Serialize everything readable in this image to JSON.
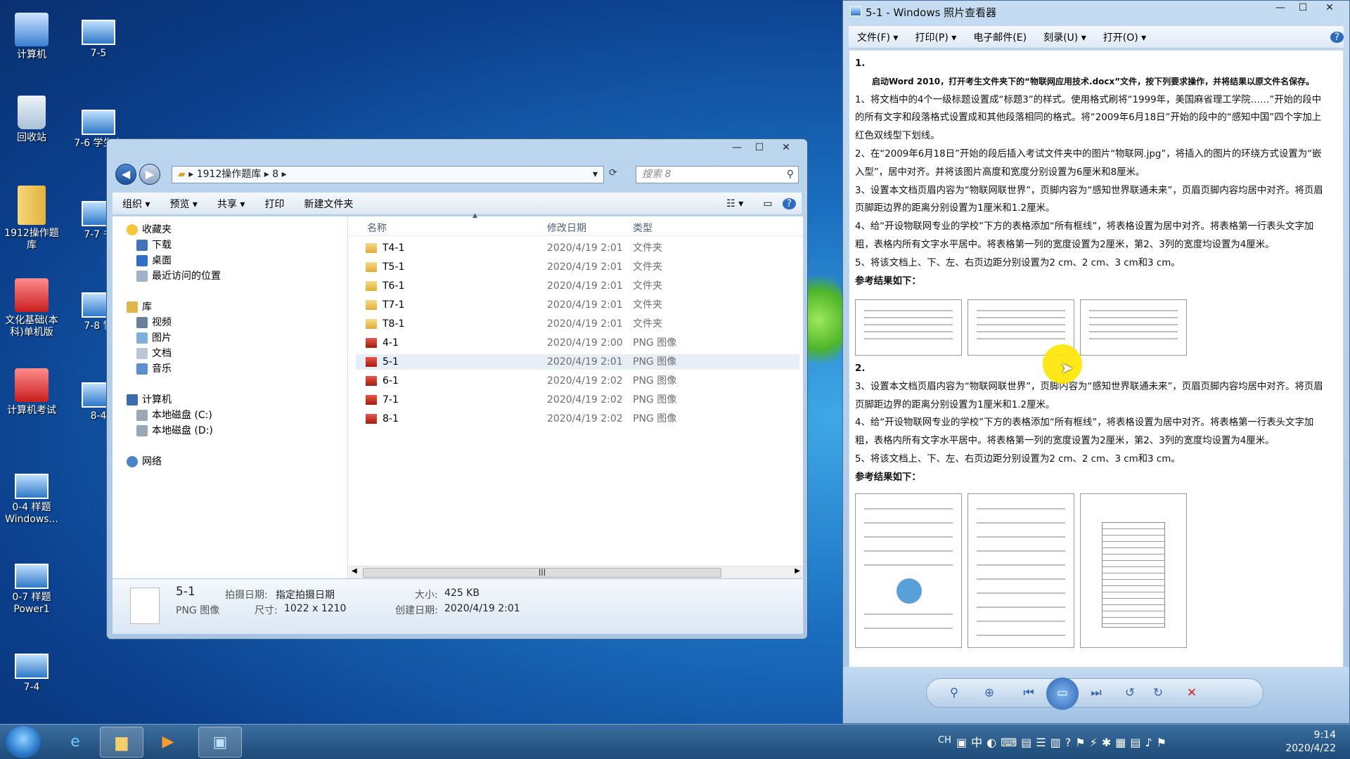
{
  "desktop": {
    "icons_left": [
      {
        "label": "计算机"
      },
      {
        "label": "回收站"
      },
      {
        "label": "1912操作题库"
      },
      {
        "label": "文化基础(本科)单机版"
      },
      {
        "label": "计算机考试"
      },
      {
        "label": "0-4 样题Windows..."
      },
      {
        "label": "0-7 样题Power1"
      },
      {
        "label": "7-4"
      }
    ],
    "icons_second": [
      {
        "label": "7-5"
      },
      {
        "label": "7-6 学生表"
      },
      {
        "label": "7-7 书"
      },
      {
        "label": "7-8 雪"
      },
      {
        "label": "8-4"
      }
    ]
  },
  "explorer": {
    "address": [
      "1912操作题库",
      "8"
    ],
    "search_placeholder": "搜索 8",
    "toolbar": [
      "组织 ▾",
      "预览 ▾",
      "共享 ▾",
      "打印",
      "新建文件夹"
    ],
    "nav": {
      "favorites": "收藏夹",
      "fav_items": [
        "下载",
        "桌面",
        "最近访问的位置"
      ],
      "libraries": "库",
      "lib_items": [
        "视频",
        "图片",
        "文档",
        "音乐"
      ],
      "computer": "计算机",
      "drives": [
        "本地磁盘 (C:)",
        "本地磁盘 (D:)"
      ],
      "network": "网络"
    },
    "columns": {
      "name": "名称",
      "date": "修改日期",
      "type": "类型"
    },
    "files": [
      {
        "name": "T4-1",
        "date": "2020/4/19 2:01",
        "type": "文件夹",
        "kind": "folder"
      },
      {
        "name": "T5-1",
        "date": "2020/4/19 2:01",
        "type": "文件夹",
        "kind": "folder"
      },
      {
        "name": "T6-1",
        "date": "2020/4/19 2:01",
        "type": "文件夹",
        "kind": "folder"
      },
      {
        "name": "T7-1",
        "date": "2020/4/19 2:01",
        "type": "文件夹",
        "kind": "folder"
      },
      {
        "name": "T8-1",
        "date": "2020/4/19 2:01",
        "type": "文件夹",
        "kind": "folder"
      },
      {
        "name": "4-1",
        "date": "2020/4/19 2:00",
        "type": "PNG 图像",
        "kind": "png"
      },
      {
        "name": "5-1",
        "date": "2020/4/19 2:01",
        "type": "PNG 图像",
        "kind": "png",
        "selected": true
      },
      {
        "name": "6-1",
        "date": "2020/4/19 2:02",
        "type": "PNG 图像",
        "kind": "png"
      },
      {
        "name": "7-1",
        "date": "2020/4/19 2:02",
        "type": "PNG 图像",
        "kind": "png"
      },
      {
        "name": "8-1",
        "date": "2020/4/19 2:02",
        "type": "PNG 图像",
        "kind": "png"
      }
    ],
    "details": {
      "name": "5-1",
      "type": "PNG 图像",
      "taken_label": "拍摄日期:",
      "taken_value": "指定拍摄日期",
      "dims_label": "尺寸:",
      "dims_value": "1022 x 1210",
      "size_label": "大小:",
      "size_value": "425 KB",
      "created_label": "创建日期:",
      "created_value": "2020/4/19 2:01"
    }
  },
  "viewer": {
    "title": "5-1 - Windows 照片查看器",
    "menu": [
      "文件(F) ▾",
      "打印(P) ▾",
      "电子邮件(E)",
      "刻录(U) ▾",
      "打开(O) ▾"
    ],
    "doc": {
      "num1": "1.",
      "intro": "启动Word 2010，打开考生文件夹下的“物联网应用技术.docx”文件，按下列要求操作，并将结果以原文件名保存。",
      "p1": "1、将文档中的4个一级标题设置成“标题3”的样式。使用格式刷将“1999年，美国麻省理工学院……”开始的段中的所有文字和段落格式设置成和其他段落相同的格式。将“2009年6月18日”开始的段中的“感知中国”四个字加上红色双线型下划线。",
      "p2": "2、在“2009年6月18日”开始的段后插入考试文件夹中的图片“物联网.jpg”，将插入的图片的环绕方式设置为“嵌入型”，居中对齐。并将该图片高度和宽度分别设置为6厘米和8厘米。",
      "p3": "3、设置本文档页眉内容为“物联网联世界”，页脚内容为“感知世界联通未来”，页眉页脚内容均居中对齐。将页眉页脚距边界的距离分别设置为1厘米和1.2厘米。",
      "p4": "4、给“开设物联网专业的学校”下方的表格添加“所有框线”，将表格设置为居中对齐。将表格第一行表头文字加粗，表格内所有文字水平居中。将表格第一列的宽度设置为2厘米，第2、3列的宽度均设置为4厘米。",
      "p5": "5、将该文档上、下、左、右页边距分别设置为2 cm、2 cm、3 cm和3 cm。",
      "ref": "参考结果如下：",
      "num2": "2."
    }
  },
  "taskbar": {
    "lang": "CH",
    "time": "9:14",
    "date": "2020/4/22"
  }
}
